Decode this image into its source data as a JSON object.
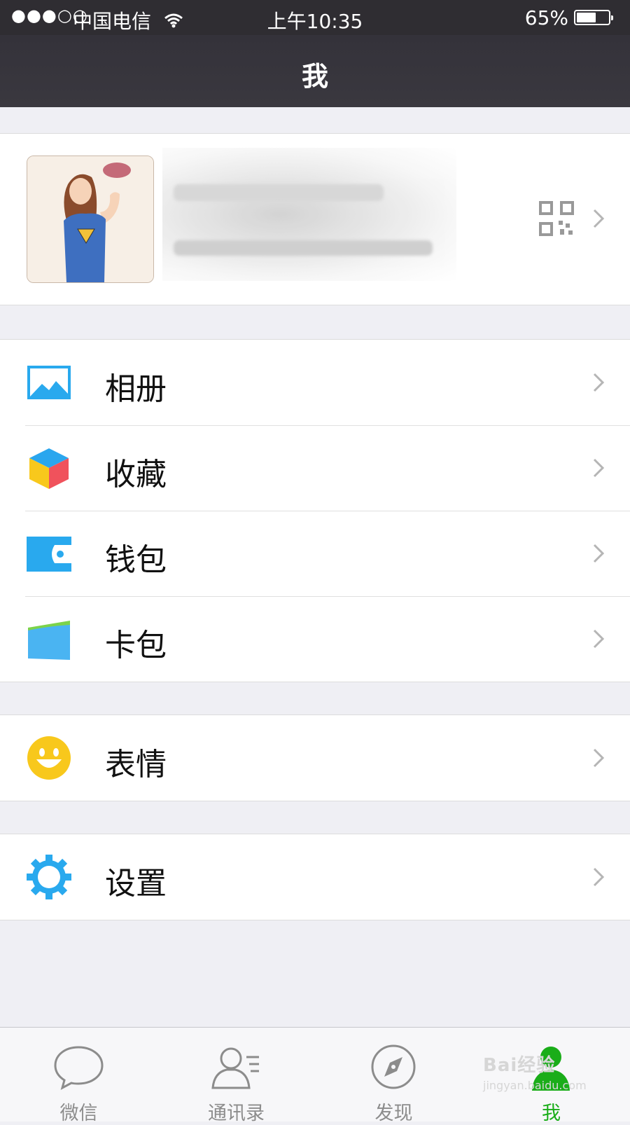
{
  "status_bar": {
    "signal": "●●●○○",
    "carrier": "中国电信",
    "time": "上午10:35",
    "battery_percent": "65%",
    "battery_level": 0.65
  },
  "nav": {
    "title": "我"
  },
  "menu_groups": [
    [
      {
        "label": "相册",
        "icon": "photo-album-icon"
      },
      {
        "label": "收藏",
        "icon": "favorites-cube-icon"
      },
      {
        "label": "钱包",
        "icon": "wallet-icon"
      },
      {
        "label": "卡包",
        "icon": "card-pack-icon"
      }
    ],
    [
      {
        "label": "表情",
        "icon": "smiley-icon"
      }
    ],
    [
      {
        "label": "设置",
        "icon": "settings-gear-icon"
      }
    ]
  ],
  "tabs": [
    {
      "label": "微信",
      "icon": "chat-bubble-icon",
      "active": false
    },
    {
      "label": "通讯录",
      "icon": "contacts-icon",
      "active": false
    },
    {
      "label": "发现",
      "icon": "compass-icon",
      "active": false
    },
    {
      "label": "我",
      "icon": "me-person-icon",
      "active": true
    }
  ],
  "colors": {
    "active_tab": "#1aad19",
    "icon_blue": "#29a9ee",
    "smiley_yellow": "#f8c81c"
  },
  "watermark": {
    "text": "Bai经验",
    "sub": "jingyan.baidu.com"
  }
}
